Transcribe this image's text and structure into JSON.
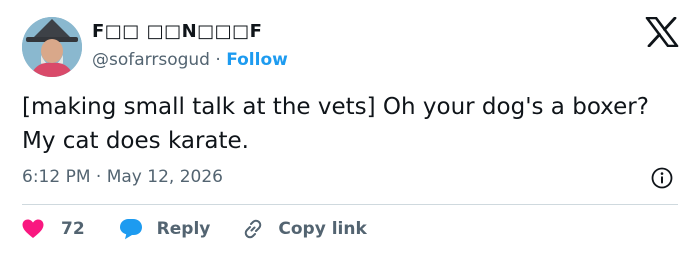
{
  "tweet": {
    "author": {
      "display_name": "F□□ □□N□□□F",
      "handle": "@sofarrsogud",
      "separator": "·",
      "follow_label": "Follow"
    },
    "text": "[making small talk at the vets] Oh your dog's a boxer? My cat does karate.",
    "time": "6:12 PM",
    "date_separator": "·",
    "date": "May 12, 2026",
    "actions": {
      "like_count": "72",
      "reply_label": "Reply",
      "copy_link_label": "Copy link"
    }
  },
  "colors": {
    "like": "#f91880",
    "reply": "#1d9bf0",
    "follow": "#1d9bf0",
    "muted": "#536471",
    "divider": "#cfd9de"
  },
  "icons": [
    "avatar",
    "x-logo-icon",
    "info-icon",
    "heart-icon",
    "reply-bubble-icon",
    "link-icon"
  ]
}
